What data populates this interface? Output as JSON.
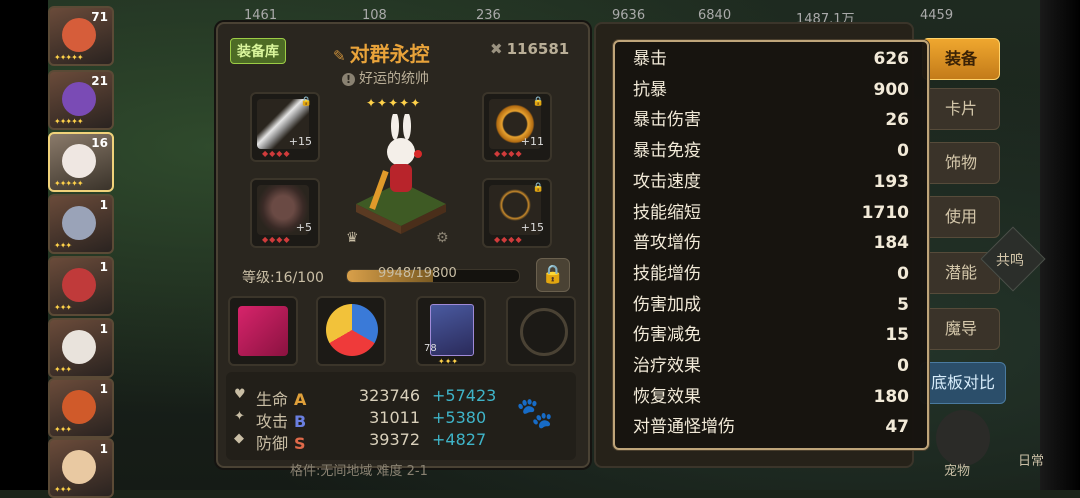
{
  "topbar": {
    "values": [
      "1461",
      "108",
      "236",
      "9636",
      "6840",
      "1487.1万",
      "4459"
    ]
  },
  "hero_list": [
    {
      "level": "71",
      "stars": "✦✦✦✦✦",
      "color": "#d65d3a",
      "selected": false
    },
    {
      "level": "21",
      "stars": "✦✦✦✦✦",
      "color": "#7a4bb5",
      "selected": false
    },
    {
      "level": "16",
      "stars": "✦✦✦✦✦",
      "color": "#efe7e2",
      "selected": true
    },
    {
      "level": "1",
      "stars": "✦✦✦",
      "color": "#9aa3b8",
      "selected": false
    },
    {
      "level": "1",
      "stars": "✦✦✦",
      "color": "#c03a3a",
      "selected": false
    },
    {
      "level": "1",
      "stars": "✦✦✦",
      "color": "#e9e3dc",
      "selected": false
    },
    {
      "level": "1",
      "stars": "✦✦✦",
      "color": "#d05a2a",
      "selected": false
    },
    {
      "level": "1",
      "stars": "✦✦✦",
      "color": "#e9c9a2",
      "selected": false
    }
  ],
  "panel": {
    "badge": "装备库",
    "hero_name": "对群永控",
    "subtitle": "好运的统帅",
    "power": "116581",
    "hero_stars": "✦✦✦✦✦",
    "level_label": "等级:16/100",
    "xp_text": "9948/19800",
    "xp_fraction": 0.5024,
    "slots": [
      {
        "plus": "+15",
        "dots": "◆◆◆◆"
      },
      {
        "plus": "+11",
        "dots": "◆◆◆◆"
      },
      {
        "plus": "+5",
        "dots": "◆◆◆◆"
      },
      {
        "plus": "+15",
        "dots": "◆◆◆◆"
      }
    ],
    "card_count": "78",
    "stats": [
      {
        "icon": "♥",
        "name": "生命",
        "grade": "A",
        "grade_color": "#e0a03a",
        "value": "323746",
        "bonus": "+57423"
      },
      {
        "icon": "✦",
        "name": "攻击",
        "grade": "B",
        "grade_color": "#6a7fe0",
        "value": "31011",
        "bonus": "+5380"
      },
      {
        "icon": "◆",
        "name": "防御",
        "grade": "S",
        "grade_color": "#e06a4a",
        "value": "39372",
        "bonus": "+4827"
      }
    ],
    "status_text": "格件:无间地域 难度 2-1"
  },
  "side_buttons": [
    "装备",
    "卡片",
    "饰物",
    "使用",
    "潜能",
    "魔导",
    "底板对比"
  ],
  "gongming": "共鸣",
  "pet_label": "宠物",
  "pet_label2": "日常",
  "popup": {
    "rows": [
      {
        "k": "暴击",
        "v": "626"
      },
      {
        "k": "抗暴",
        "v": "900"
      },
      {
        "k": "暴击伤害",
        "v": "26"
      },
      {
        "k": "暴击免疫",
        "v": "0"
      },
      {
        "k": "攻击速度",
        "v": "193"
      },
      {
        "k": "技能缩短",
        "v": "1710"
      },
      {
        "k": "普攻增伤",
        "v": "184"
      },
      {
        "k": "技能增伤",
        "v": "0"
      },
      {
        "k": "伤害加成",
        "v": "5"
      },
      {
        "k": "伤害减免",
        "v": "15"
      },
      {
        "k": "治疗效果",
        "v": "0"
      },
      {
        "k": "恢复效果",
        "v": "180"
      },
      {
        "k": "对普通怪增伤",
        "v": "47"
      }
    ]
  }
}
